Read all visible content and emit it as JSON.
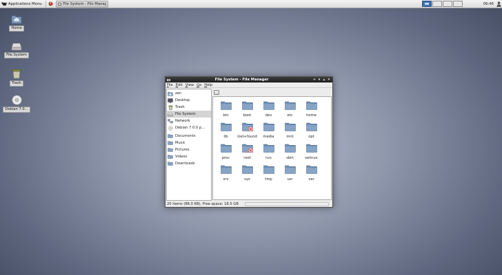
{
  "panel": {
    "apps_menu_label": "Applications Menu",
    "taskbar_button": "File System - File Manager",
    "clock": "06:46",
    "workspace_colors": {
      "active": "#3e6fb6"
    }
  },
  "desktop": {
    "icons": [
      {
        "label": "Home",
        "icon": "home-folder-icon"
      },
      {
        "label": "File System",
        "icon": "drive-icon"
      },
      {
        "label": "Trash",
        "icon": "trash-icon"
      },
      {
        "label": "Debian 7.0...",
        "icon": "cdrom-icon"
      }
    ]
  },
  "window": {
    "title": "File System - File Manager",
    "menu": [
      "File",
      "Edit",
      "View",
      "Go",
      "Help"
    ],
    "sidebar": {
      "places": [
        {
          "label": "zen",
          "icon": "home-icon"
        },
        {
          "label": "Desktop",
          "icon": "desktop-icon"
        },
        {
          "label": "Trash",
          "icon": "trash-icon"
        },
        {
          "label": "File System",
          "icon": "drive-icon",
          "selected": true
        },
        {
          "label": "Network",
          "icon": "network-icon"
        },
        {
          "label": "Debian 7.0.0 p...",
          "icon": "cdrom-icon"
        }
      ],
      "bookmarks": [
        {
          "label": "Documents",
          "icon": "folder-icon"
        },
        {
          "label": "Music",
          "icon": "folder-icon"
        },
        {
          "label": "Pictures",
          "icon": "folder-icon"
        },
        {
          "label": "Videos",
          "icon": "folder-icon"
        },
        {
          "label": "Downloads",
          "icon": "folder-icon"
        }
      ]
    },
    "files": [
      {
        "name": "bin"
      },
      {
        "name": "boot"
      },
      {
        "name": "dev"
      },
      {
        "name": "etc"
      },
      {
        "name": "home"
      },
      {
        "name": "lib"
      },
      {
        "name": "lost+found",
        "locked": true
      },
      {
        "name": "media"
      },
      {
        "name": "mnt"
      },
      {
        "name": "opt"
      },
      {
        "name": "proc"
      },
      {
        "name": "root",
        "locked": true
      },
      {
        "name": "run"
      },
      {
        "name": "sbin"
      },
      {
        "name": "selinux"
      },
      {
        "name": "srv"
      },
      {
        "name": "sys"
      },
      {
        "name": "tmp"
      },
      {
        "name": "usr"
      },
      {
        "name": "var"
      }
    ],
    "status": "20 items (88.0 KB), Free space: 18.5 GB"
  }
}
